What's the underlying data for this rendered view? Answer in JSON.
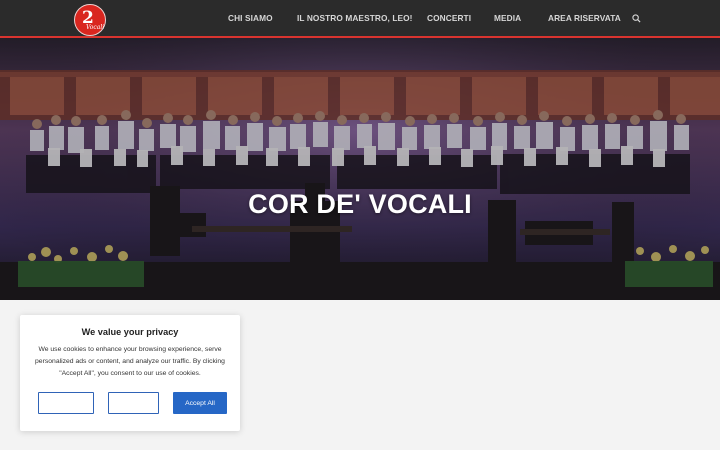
{
  "header": {
    "logo_mark": "2",
    "logo_text": "Vocali",
    "nav": [
      {
        "label": "CHI SIAMO"
      },
      {
        "label": "IL NOSTRO MAESTRO, LEO!"
      },
      {
        "label": "CONCERTI"
      },
      {
        "label": "MEDIA"
      },
      {
        "label": "AREA RISERVATA"
      }
    ],
    "search_icon": "search-icon"
  },
  "hero": {
    "title": "COR DE' VOCALI"
  },
  "cookie_banner": {
    "title": "We value your privacy",
    "text": "We use cookies to enhance your browsing experience, serve personalized ads or content, and analyze our traffic. By clicking \"Accept All\", you consent to our use of cookies.",
    "buttons": [
      {
        "label": ""
      },
      {
        "label": ""
      },
      {
        "label": "Accept All"
      }
    ]
  },
  "colors": {
    "header_bg": "#2b2b2b",
    "header_accent": "#d9342f",
    "button_blue": "#2667c6",
    "hero_tint": "#3f2d55"
  }
}
